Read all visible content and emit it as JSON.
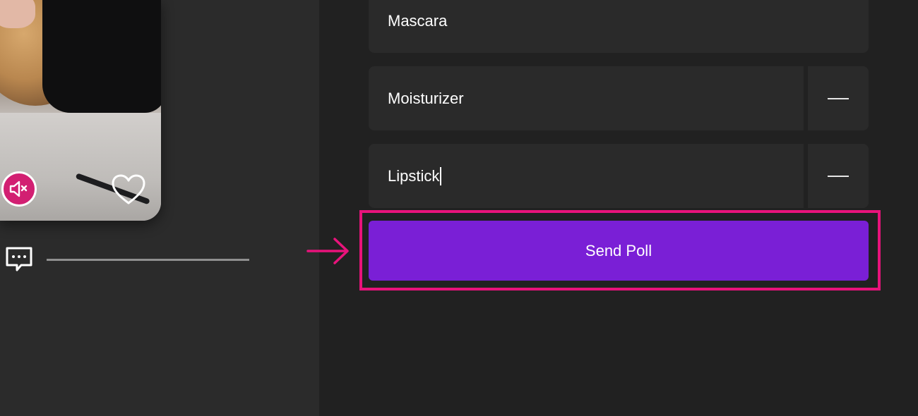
{
  "poll": {
    "options": [
      {
        "value": "Mascara",
        "removable": false
      },
      {
        "value": "Moisturizer",
        "removable": true
      },
      {
        "value": "Lipstick",
        "removable": true
      }
    ],
    "send_label": "Send Poll"
  },
  "icons": {
    "mute": "speaker-muted-icon",
    "like": "heart-icon",
    "comment": "chat-bubble-icon",
    "remove": "minus-icon",
    "annotation_arrow": "arrow-right-icon"
  },
  "colors": {
    "accent": "#7a1fd6",
    "highlight": "#e8137b",
    "mute_button": "#d21f72"
  }
}
